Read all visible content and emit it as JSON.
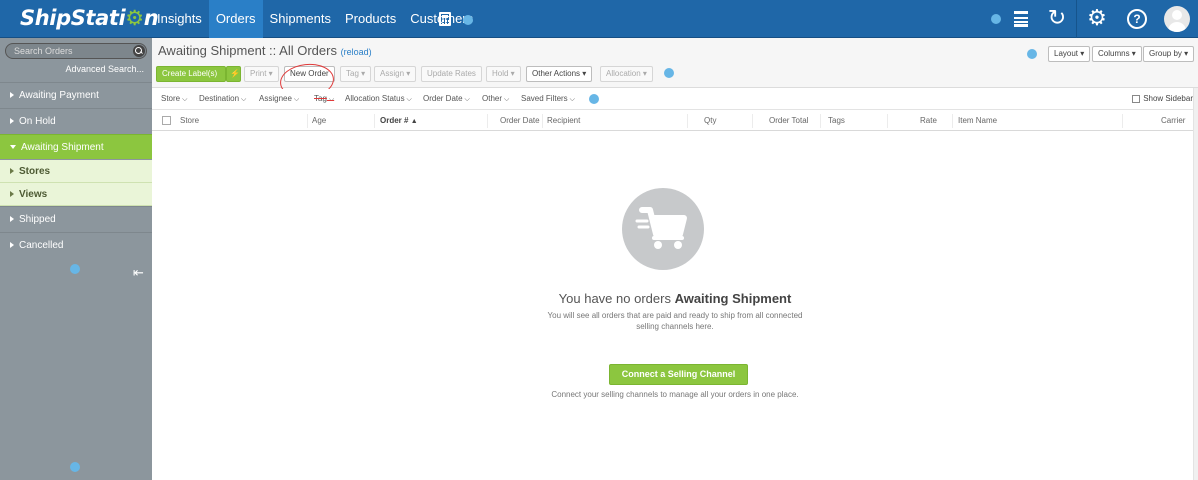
{
  "brand": {
    "logo_text": "ShipStati",
    "logo_gear": "⚙",
    "logo_tail": "n"
  },
  "nav": {
    "links": [
      {
        "label": "Insights",
        "active": false
      },
      {
        "label": "Orders",
        "active": true
      },
      {
        "label": "Shipments",
        "active": false
      },
      {
        "label": "Products",
        "active": false
      },
      {
        "label": "Customers",
        "active": false
      }
    ],
    "icons": [
      "calculator-icon",
      "batch-icon",
      "refresh-icon",
      "gear-icon",
      "help-icon",
      "avatar-icon"
    ]
  },
  "sidebar": {
    "search_placeholder": "Search Orders",
    "advanced_search": "Advanced Search...",
    "items": [
      {
        "label": "Awaiting Payment"
      },
      {
        "label": "On Hold"
      },
      {
        "label": "Awaiting Shipment"
      },
      {
        "label": "Shipped"
      },
      {
        "label": "Cancelled"
      }
    ],
    "sub_items": [
      {
        "label": "Stores"
      },
      {
        "label": "Views"
      }
    ]
  },
  "header": {
    "title": "Awaiting Shipment :: All Orders",
    "reload": "(reload)",
    "toolbar": {
      "create_label": "Create Label(s)",
      "bolt": "⚡",
      "print": "Print",
      "new_order": "New Order",
      "tag": "Tag",
      "assign": "Assign",
      "update_rates": "Update Rates",
      "hold": "Hold",
      "other_actions": "Other Actions",
      "allocation": "Allocation"
    },
    "view_controls": {
      "layout": "Layout",
      "columns": "Columns",
      "group_by": "Group by"
    }
  },
  "filters": {
    "items": [
      "Store",
      "Destination",
      "Assignee",
      "Tag",
      "Allocation Status",
      "Order Date",
      "Other",
      "Saved Filters"
    ],
    "show_sidebar": "Show Sidebar"
  },
  "table": {
    "columns": [
      "Store",
      "Age",
      "Order #",
      "Order Date",
      "Recipient",
      "Qty",
      "Order Total",
      "Tags",
      "Rate",
      "Item Name",
      "Carrier"
    ],
    "sort_indicator": "▲"
  },
  "empty_state": {
    "title_prefix": "You have no orders ",
    "title_bold": "Awaiting Shipment",
    "description": "You will see all orders that are paid and ready to ship from all connected selling channels here.",
    "cta": "Connect a Selling Channel",
    "note": "Connect your selling channels to manage all your orders in one place."
  },
  "colors": {
    "nav": "#1f67a8",
    "nav_active": "#2a7fc7",
    "accent_green": "#8cc63f",
    "sidebar": "#8c969d",
    "annotation": "#e03a3a"
  }
}
